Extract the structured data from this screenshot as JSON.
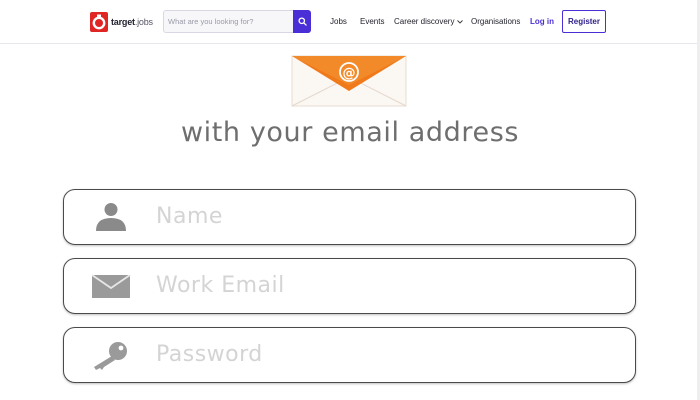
{
  "header": {
    "logo_name": "target",
    "logo_suffix": ".jobs",
    "search_placeholder": "What are you looking for?",
    "nav": {
      "jobs": "Jobs",
      "events": "Events",
      "career": "Career discovery",
      "organisations": "Organisations",
      "login": "Log in",
      "register": "Register"
    }
  },
  "hero": {
    "headline": "with your email address",
    "envelope_symbol": "@"
  },
  "form": {
    "name_placeholder": "Name",
    "email_placeholder": "Work Email",
    "password_placeholder": "Password"
  },
  "colors": {
    "brand_purple": "#4b2fd6",
    "logo_red": "#e02525",
    "envelope_orange": "#f07a1a"
  }
}
